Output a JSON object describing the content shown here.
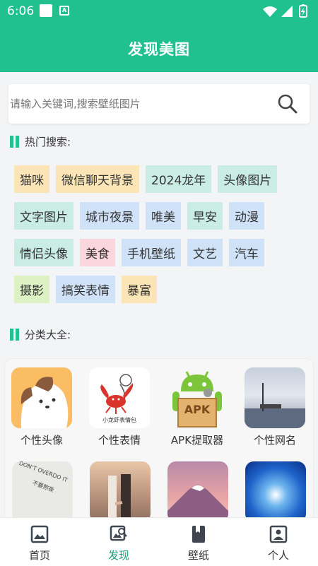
{
  "status_bar": {
    "time": "6:06",
    "badge": "A"
  },
  "header": {
    "title": "发现美图"
  },
  "search": {
    "placeholder": "请输入关键词,搜索壁纸图片",
    "value": ""
  },
  "hot": {
    "title": "热门搜索:",
    "tags": [
      {
        "label": "猫咪",
        "color": "#fbe5b6"
      },
      {
        "label": "微信聊天背景",
        "color": "#fbe5b6"
      },
      {
        "label": "2024龙年",
        "color": "#c9ede3"
      },
      {
        "label": "头像图片",
        "color": "#c9ede3"
      },
      {
        "label": "文字图片",
        "color": "#c9ede3"
      },
      {
        "label": "城市夜景",
        "color": "#cfe2f8"
      },
      {
        "label": "唯美",
        "color": "#cfe2f8"
      },
      {
        "label": "早安",
        "color": "#c9ede3"
      },
      {
        "label": "动漫",
        "color": "#cfe2f8"
      },
      {
        "label": "情侣头像",
        "color": "#c9ede3"
      },
      {
        "label": "美食",
        "color": "#fcd6de"
      },
      {
        "label": "手机壁纸",
        "color": "#cfe2f8"
      },
      {
        "label": "文艺",
        "color": "#cfe2f8"
      },
      {
        "label": "汽车",
        "color": "#cfe2f8"
      },
      {
        "label": "摄影",
        "color": "#ddf2c4"
      },
      {
        "label": "搞笑表情",
        "color": "#cfe2f8"
      },
      {
        "label": "暴富",
        "color": "#fbe5b6"
      }
    ]
  },
  "categories": {
    "title": "分类大全:",
    "items": [
      {
        "label": "个性头像"
      },
      {
        "label": "个性表情"
      },
      {
        "label": "APK提取器"
      },
      {
        "label": "个性网名"
      }
    ],
    "thumb_texts": {
      "sticker": "小龙虾表情包",
      "apk": "APK",
      "note": "DON'T OVERDO IT",
      "note_cn": "不要熬夜"
    }
  },
  "nav": {
    "items": [
      {
        "label": "首页"
      },
      {
        "label": "发现"
      },
      {
        "label": "壁纸"
      },
      {
        "label": "个人"
      }
    ],
    "active_color": "#1a9f77"
  },
  "colors": {
    "accent": "#21c18e"
  }
}
